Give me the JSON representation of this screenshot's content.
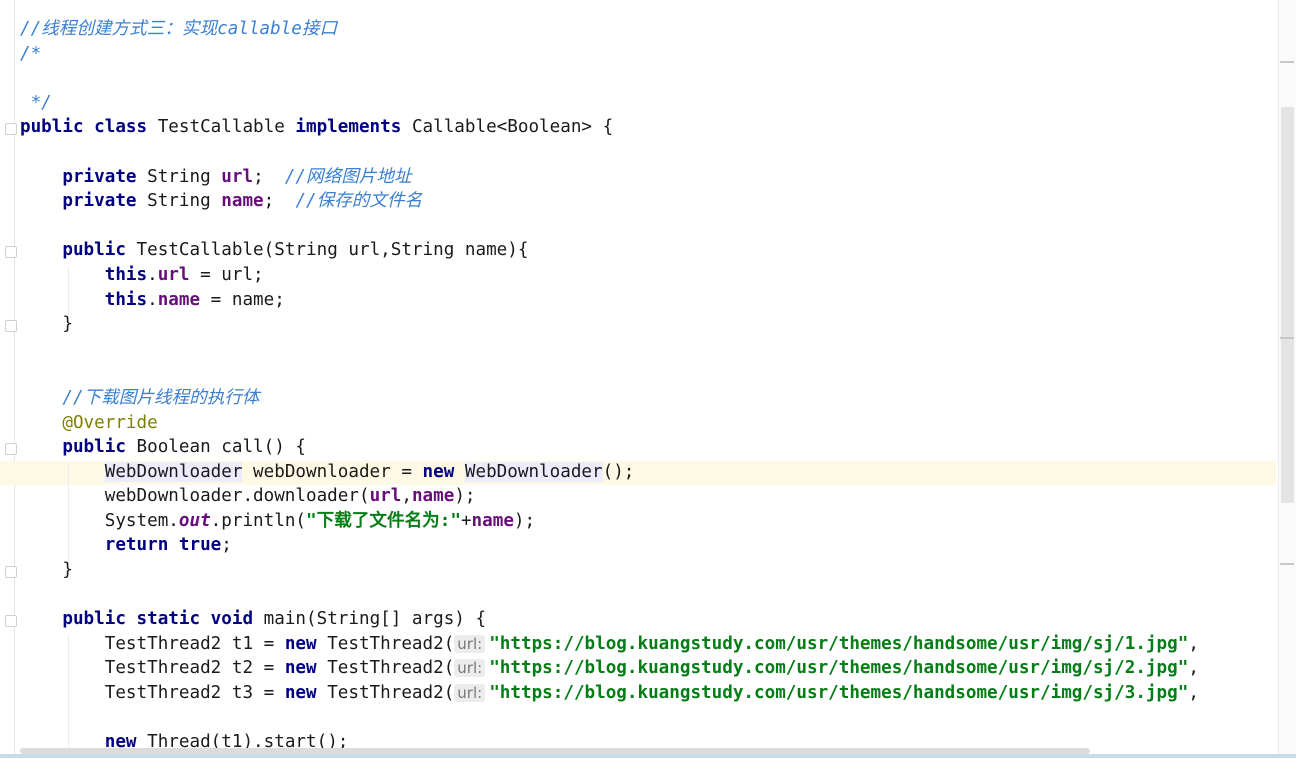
{
  "editor": {
    "lines": [
      {
        "segments": [
          {
            "t": "cm",
            "v": "//线程创建方式三：实现callable接口"
          }
        ]
      },
      {
        "segments": [
          {
            "t": "cm",
            "v": "/*"
          }
        ]
      },
      {
        "segments": []
      },
      {
        "segments": [
          {
            "t": "cm",
            "v": " */"
          }
        ]
      },
      {
        "segments": [
          {
            "t": "kw",
            "v": "public class "
          },
          {
            "t": "txt",
            "v": "TestCallable "
          },
          {
            "t": "kw",
            "v": "implements "
          },
          {
            "t": "txt",
            "v": "Callable<Boolean> {"
          }
        ]
      },
      {
        "segments": []
      },
      {
        "segments": [
          {
            "t": "txt",
            "v": "    "
          },
          {
            "t": "kw",
            "v": "private "
          },
          {
            "t": "txt",
            "v": "String "
          },
          {
            "t": "fld",
            "v": "url"
          },
          {
            "t": "txt",
            "v": ";  "
          },
          {
            "t": "cm",
            "v": "//网络图片地址"
          }
        ]
      },
      {
        "segments": [
          {
            "t": "txt",
            "v": "    "
          },
          {
            "t": "kw",
            "v": "private "
          },
          {
            "t": "txt",
            "v": "String "
          },
          {
            "t": "fld",
            "v": "name"
          },
          {
            "t": "txt",
            "v": ";  "
          },
          {
            "t": "cm",
            "v": "//保存的文件名"
          }
        ]
      },
      {
        "segments": []
      },
      {
        "segments": [
          {
            "t": "txt",
            "v": "    "
          },
          {
            "t": "kw",
            "v": "public "
          },
          {
            "t": "txt",
            "v": "TestCallable(String url,String name){"
          }
        ]
      },
      {
        "segments": [
          {
            "t": "txt",
            "v": "        "
          },
          {
            "t": "kw",
            "v": "this"
          },
          {
            "t": "txt",
            "v": "."
          },
          {
            "t": "fld",
            "v": "url"
          },
          {
            "t": "txt",
            "v": " = url;"
          }
        ]
      },
      {
        "segments": [
          {
            "t": "txt",
            "v": "        "
          },
          {
            "t": "kw",
            "v": "this"
          },
          {
            "t": "txt",
            "v": "."
          },
          {
            "t": "fld",
            "v": "name"
          },
          {
            "t": "txt",
            "v": " = name;"
          }
        ]
      },
      {
        "segments": [
          {
            "t": "txt",
            "v": "    }"
          }
        ]
      },
      {
        "segments": []
      },
      {
        "segments": []
      },
      {
        "segments": [
          {
            "t": "txt",
            "v": "    "
          },
          {
            "t": "cm",
            "v": "//下载图片线程的执行体"
          }
        ]
      },
      {
        "segments": [
          {
            "t": "txt",
            "v": "    "
          },
          {
            "t": "ann",
            "v": "@Override"
          }
        ]
      },
      {
        "segments": [
          {
            "t": "txt",
            "v": "    "
          },
          {
            "t": "kw",
            "v": "public "
          },
          {
            "t": "txt",
            "v": "Boolean call() {"
          }
        ]
      },
      {
        "segments": [
          {
            "t": "txt",
            "v": "        "
          },
          {
            "t": "hl",
            "v": "WebDownloader"
          },
          {
            "t": "txt",
            "v": " webDownloader = "
          },
          {
            "t": "kw",
            "v": "new "
          },
          {
            "t": "hl",
            "v": "WebDownloader"
          },
          {
            "t": "txt",
            "v": "();"
          }
        ]
      },
      {
        "segments": [
          {
            "t": "txt",
            "v": "        webDownloader.downloader("
          },
          {
            "t": "fld",
            "v": "url"
          },
          {
            "t": "txt",
            "v": ","
          },
          {
            "t": "fld",
            "v": "name"
          },
          {
            "t": "txt",
            "v": ");"
          }
        ]
      },
      {
        "segments": [
          {
            "t": "txt",
            "v": "        System."
          },
          {
            "t": "sfld",
            "v": "out"
          },
          {
            "t": "txt",
            "v": ".println("
          },
          {
            "t": "str",
            "v": "\"下载了文件名为:\""
          },
          {
            "t": "txt",
            "v": "+"
          },
          {
            "t": "fld",
            "v": "name"
          },
          {
            "t": "txt",
            "v": ");"
          }
        ]
      },
      {
        "segments": [
          {
            "t": "txt",
            "v": "        "
          },
          {
            "t": "kw",
            "v": "return true"
          },
          {
            "t": "txt",
            "v": ";"
          }
        ]
      },
      {
        "segments": [
          {
            "t": "txt",
            "v": "    }"
          }
        ]
      },
      {
        "segments": []
      },
      {
        "segments": [
          {
            "t": "txt",
            "v": "    "
          },
          {
            "t": "kw",
            "v": "public static void "
          },
          {
            "t": "txt",
            "v": "main(String[] args) {"
          }
        ]
      },
      {
        "segments": [
          {
            "t": "txt",
            "v": "        TestThread2 t1 = "
          },
          {
            "t": "kw",
            "v": "new "
          },
          {
            "t": "txt",
            "v": "TestThread2("
          },
          {
            "t": "hint",
            "v": "url:"
          },
          {
            "t": "str",
            "v": "\"https://blog.kuangstudy.com/usr/themes/handsome/usr/img/sj/1.jpg\""
          },
          {
            "t": "txt",
            "v": ","
          }
        ]
      },
      {
        "segments": [
          {
            "t": "txt",
            "v": "        TestThread2 t2 = "
          },
          {
            "t": "kw",
            "v": "new "
          },
          {
            "t": "txt",
            "v": "TestThread2("
          },
          {
            "t": "hint",
            "v": "url:"
          },
          {
            "t": "str",
            "v": "\"https://blog.kuangstudy.com/usr/themes/handsome/usr/img/sj/2.jpg\""
          },
          {
            "t": "txt",
            "v": ","
          }
        ]
      },
      {
        "segments": [
          {
            "t": "txt",
            "v": "        TestThread2 t3 = "
          },
          {
            "t": "kw",
            "v": "new "
          },
          {
            "t": "txt",
            "v": "TestThread2("
          },
          {
            "t": "hint",
            "v": "url:"
          },
          {
            "t": "str",
            "v": "\"https://blog.kuangstudy.com/usr/themes/handsome/usr/img/sj/3.jpg\""
          },
          {
            "t": "txt",
            "v": ","
          }
        ]
      },
      {
        "segments": []
      },
      {
        "segments": [
          {
            "t": "txt",
            "v": "        "
          },
          {
            "t": "kw",
            "v": "new "
          },
          {
            "t": "txt",
            "v": "Thread(t1).start();"
          }
        ]
      }
    ]
  }
}
